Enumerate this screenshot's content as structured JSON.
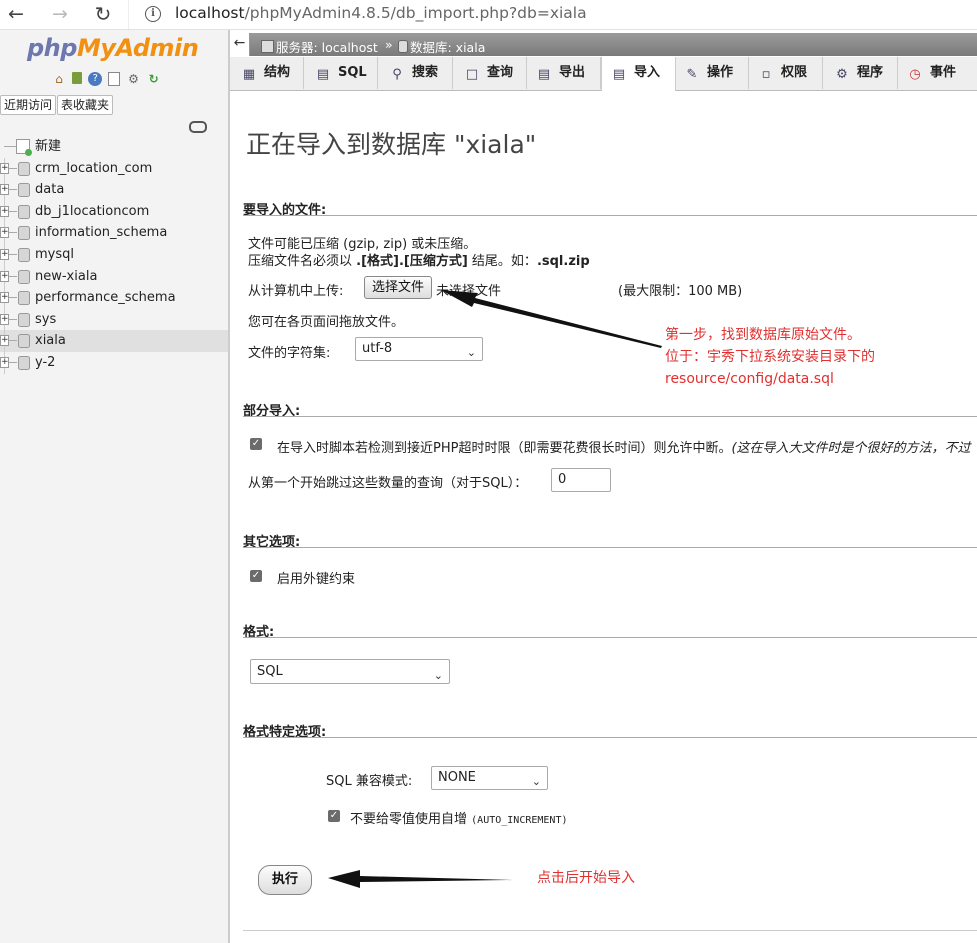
{
  "browser": {
    "url_host": "localhost",
    "url_path": "/phpMyAdmin4.8.5/db_import.php?db=xiala"
  },
  "sidebar": {
    "logo_php": "php",
    "logo_myadmin": "MyAdmin",
    "recent_tab": "近期访问",
    "favorites_tab": "表收藏夹",
    "new_label": "新建",
    "databases": [
      "crm_location_com",
      "data",
      "db_j1locationcom",
      "information_schema",
      "mysql",
      "new-xiala",
      "performance_schema",
      "sys",
      "xiala",
      "y-2"
    ],
    "selected": "xiala"
  },
  "breadcrumb": {
    "collapse": "←",
    "server": "服务器: localhost",
    "sep": "»",
    "database": "数据库: xiala"
  },
  "tabs": [
    {
      "label": "结构",
      "icon": "structure-icon"
    },
    {
      "label": "SQL",
      "icon": "sql-icon"
    },
    {
      "label": "搜索",
      "icon": "search-icon"
    },
    {
      "label": "查询",
      "icon": "query-icon"
    },
    {
      "label": "导出",
      "icon": "export-icon"
    },
    {
      "label": "导入",
      "icon": "import-icon"
    },
    {
      "label": "操作",
      "icon": "operations-icon"
    },
    {
      "label": "权限",
      "icon": "privileges-icon"
    },
    {
      "label": "程序",
      "icon": "routines-icon"
    },
    {
      "label": "事件",
      "icon": "events-icon"
    }
  ],
  "active_tab": "导入",
  "page": {
    "title": "正在导入到数据库 \"xiala\"",
    "file_section": "要导入的文件:",
    "file_hint1": "文件可能已压缩 (gzip, zip) 或未压缩。",
    "file_hint2_a": "压缩文件名必须以 ",
    "file_hint2_b": ".[格式].[压缩方式]",
    "file_hint2_c": " 结尾。如：",
    "file_hint2_d": ".sql.zip",
    "upload_label": "从计算机中上传:",
    "choose_file": "选择文件",
    "no_file": "未选择文件",
    "max_limit": "(最大限制：100 MB)",
    "drag_hint": "您可在各页面间拖放文件。",
    "charset_label": "文件的字符集:",
    "charset_value": "utf-8",
    "partial_section": "部分导入:",
    "partial_check": "在导入时脚本若检测到接近PHP超时时限（即需要花费很长时间）则允许中断。",
    "partial_note": "(这在导入大文件时是个很好的方法，不过",
    "skip_label": "从第一个开始跳过这些数量的查询（对于SQL）：",
    "skip_value": "0",
    "other_section": "其它选项:",
    "fk_check": "启用外键约束",
    "format_section": "格式:",
    "format_value": "SQL",
    "format_opts_section": "格式特定选项:",
    "sql_compat_label": "SQL 兼容模式:",
    "sql_compat_value": "NONE",
    "auto_inc_check": "不要给零值使用自增",
    "auto_inc_code": "(AUTO_INCREMENT)",
    "go_button": "执行"
  },
  "annotations": {
    "step1_line1": "第一步，找到数据库原始文件。",
    "step1_line2": "位于：宇秀下拉系统安装目录下的",
    "step1_line3": " resource/config/data.sql",
    "step2": "点击后开始导入",
    "color": "#e03030"
  }
}
